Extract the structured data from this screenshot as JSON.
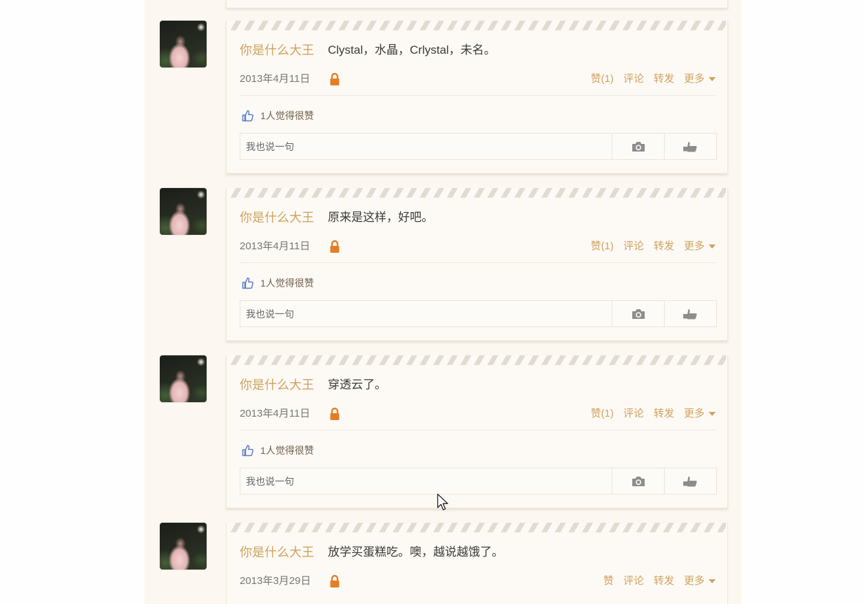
{
  "feed": {
    "posts": [
      {
        "author": "你是什么大王",
        "content": "Clystal，水晶，Crlystal，未名。",
        "date": "2013年4月11日",
        "actions": {
          "like": "赞(1)",
          "comment": "评论",
          "forward": "转发",
          "more": "更多"
        },
        "likes_text": "1人觉得很赞",
        "reply_placeholder": "我也说一句"
      },
      {
        "author": "你是什么大王",
        "content": "原来是这样，好吧。",
        "date": "2013年4月11日",
        "actions": {
          "like": "赞(1)",
          "comment": "评论",
          "forward": "转发",
          "more": "更多"
        },
        "likes_text": "1人觉得很赞",
        "reply_placeholder": "我也说一句"
      },
      {
        "author": "你是什么大王",
        "content": "穿透云了。",
        "date": "2013年4月11日",
        "actions": {
          "like": "赞(1)",
          "comment": "评论",
          "forward": "转发",
          "more": "更多"
        },
        "likes_text": "1人觉得很赞",
        "reply_placeholder": "我也说一句"
      },
      {
        "author": "你是什么大王",
        "content": "放学买蛋糕吃。噢，越说越饿了。",
        "date": "2013年3月29日",
        "actions": {
          "like": "赞",
          "comment": "评论",
          "forward": "转发",
          "more": "更多"
        }
      }
    ]
  },
  "icons": {
    "privacy": "lock-icon",
    "more": "caret-down-icon",
    "like_summary": "thumb-up-icon",
    "reply_image": "camera-icon",
    "reply_extra": "hand-icon",
    "pointer": "mouse-cursor"
  },
  "colors": {
    "page_background": "#fcf7f0",
    "author_and_links": "#cfa25f",
    "lock": "#e57d25",
    "thumb_up": "#5a7cc6",
    "content_text": "#3a3a3a",
    "date_text": "#777777"
  }
}
